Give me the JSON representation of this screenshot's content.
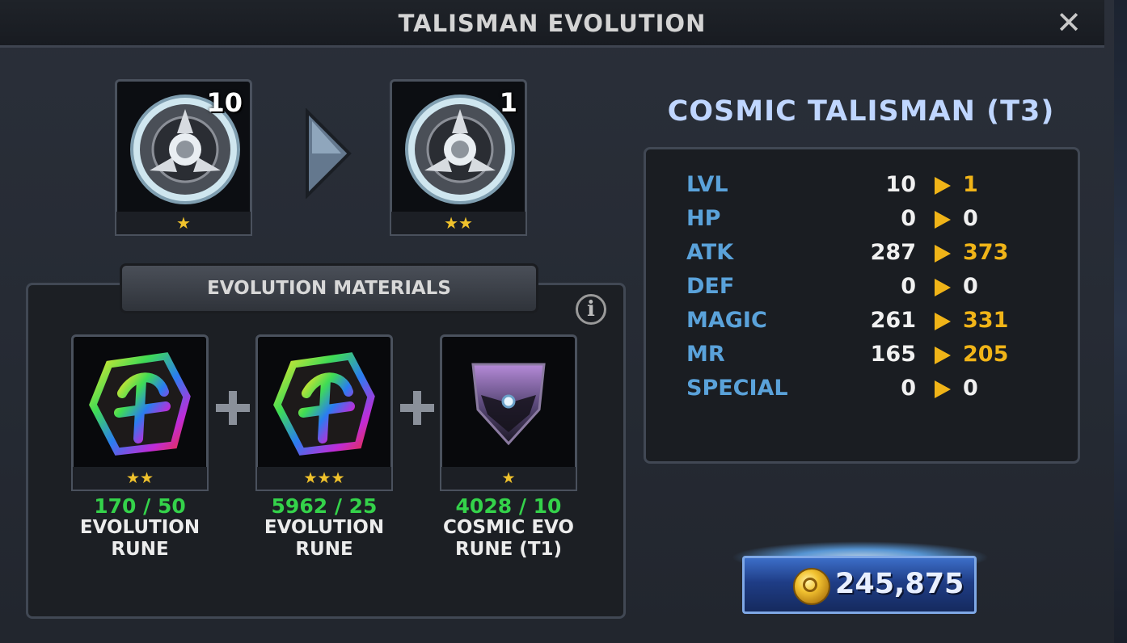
{
  "window": {
    "title": "TALISMAN EVOLUTION",
    "close_icon": "close-icon"
  },
  "evolution": {
    "from": {
      "quantity": "10",
      "stars": "★"
    },
    "to": {
      "quantity": "1",
      "stars": "★★"
    }
  },
  "item": {
    "name": "COSMIC TALISMAN (T3)"
  },
  "stats": [
    {
      "name": "LVL",
      "old": "10",
      "new": "1",
      "changed": true
    },
    {
      "name": "HP",
      "old": "0",
      "new": "0",
      "changed": false
    },
    {
      "name": "ATK",
      "old": "287",
      "new": "373",
      "changed": true
    },
    {
      "name": "DEF",
      "old": "0",
      "new": "0",
      "changed": false
    },
    {
      "name": "MAGIC",
      "old": "261",
      "new": "331",
      "changed": true
    },
    {
      "name": "MR",
      "old": "165",
      "new": "205",
      "changed": true
    },
    {
      "name": "SPECIAL",
      "old": "0",
      "new": "0",
      "changed": false
    }
  ],
  "materials": {
    "header": "EVOLUTION MATERIALS",
    "info_icon": "i",
    "items": [
      {
        "stars": "★★",
        "count": "170 / 50",
        "name": "EVOLUTION\nRUNE"
      },
      {
        "stars": "★★★",
        "count": "5962 / 25",
        "name": "EVOLUTION\nRUNE"
      },
      {
        "stars": "★",
        "count": "4028 / 10",
        "name": "COSMIC EVO\nRUNE (T1)"
      }
    ]
  },
  "cost": {
    "gold": "245,875",
    "icon": "gold-coin-icon"
  },
  "colors": {
    "stat_label": "#5aa2da",
    "stat_increase": "#f0b418",
    "stat_unchanged": "#f0f0f0",
    "material_count": "#34d24a",
    "title_accent": "#bfd6ff"
  }
}
